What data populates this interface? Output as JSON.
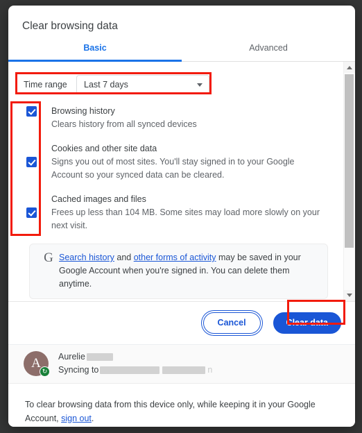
{
  "dialog": {
    "title": "Clear browsing data",
    "tabs": [
      {
        "label": "Basic",
        "active": true
      },
      {
        "label": "Advanced",
        "active": false
      }
    ],
    "time_range": {
      "label": "Time range",
      "selected": "Last 7 days",
      "caret_icon": "chevron-down-icon"
    },
    "options": [
      {
        "id": "browsing-history",
        "checked": true,
        "title": "Browsing history",
        "description": "Clears history from all synced devices"
      },
      {
        "id": "cookies-site-data",
        "checked": true,
        "title": "Cookies and other site data",
        "description": "Signs you out of most sites. You'll stay signed in to your Google Account so your synced data can be cleared."
      },
      {
        "id": "cached-images-files",
        "checked": true,
        "title": "Cached images and files",
        "description": "Frees up less than 104 MB. Some sites may load more slowly on your next visit."
      }
    ],
    "google_notice": {
      "logo_icon": "google-g-icon",
      "link1": "Search history",
      "mid": " and ",
      "link2": "other forms of activity",
      "rest": " may be saved in your Google Account when you're signed in. You can delete them anytime."
    },
    "buttons": {
      "cancel": "Cancel",
      "clear_data": "Clear data"
    },
    "sync": {
      "avatar_initial": "A",
      "avatar_color": "#8d6e6a",
      "badge_icon": "sync-icon",
      "name": "Aurelie",
      "syncing_prefix": "Syncing to",
      "syncing_tail": "n"
    },
    "footer": {
      "text_before": "To clear browsing data from this device only, while keeping it in your Google Account, ",
      "link": "sign out",
      "text_after": "."
    },
    "scrollbar": {
      "up_icon": "scroll-up-arrow-icon",
      "down_icon": "scroll-down-arrow-icon"
    }
  },
  "annotations": {
    "colors": {
      "highlight": "#f21b0c",
      "accent": "#1a73e8",
      "primary": "#1a56d6"
    }
  }
}
